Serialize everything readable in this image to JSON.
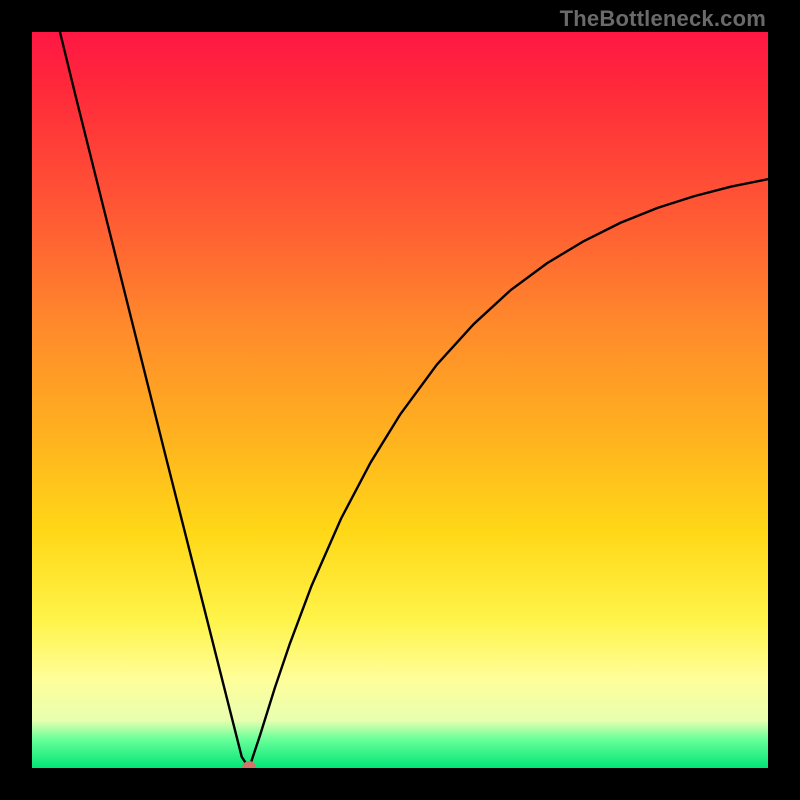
{
  "watermark": "TheBottleneck.com",
  "chart_data": {
    "type": "line",
    "title": "",
    "xlabel": "",
    "ylabel": "",
    "xlim": [
      0,
      1
    ],
    "ylim": [
      0,
      1
    ],
    "grid": false,
    "curve_note": "V-shaped curve: steep descent from top-left, hitting near-zero around x≈0.29, then rising with diminishing slope toward the right edge, asymptoting near y≈0.80.",
    "x": [
      0.038,
      0.06,
      0.08,
      0.1,
      0.12,
      0.14,
      0.16,
      0.18,
      0.2,
      0.22,
      0.24,
      0.265,
      0.285,
      0.295,
      0.31,
      0.33,
      0.35,
      0.38,
      0.42,
      0.46,
      0.5,
      0.55,
      0.6,
      0.65,
      0.7,
      0.75,
      0.8,
      0.85,
      0.9,
      0.95,
      1.0
    ],
    "y": [
      1.0,
      0.91,
      0.83,
      0.75,
      0.67,
      0.59,
      0.51,
      0.43,
      0.351,
      0.272,
      0.193,
      0.094,
      0.015,
      0.0,
      0.045,
      0.109,
      0.168,
      0.248,
      0.339,
      0.415,
      0.48,
      0.548,
      0.603,
      0.649,
      0.686,
      0.716,
      0.741,
      0.761,
      0.777,
      0.79,
      0.8
    ],
    "minimum_marker": {
      "x": 0.295,
      "y": 0.0,
      "color": "#d2746a",
      "radius_px": 7
    },
    "background_color_stops": [
      {
        "pct": 0,
        "hex": "#ff1744"
      },
      {
        "pct": 8,
        "hex": "#ff2a3a"
      },
      {
        "pct": 25,
        "hex": "#ff5a34"
      },
      {
        "pct": 40,
        "hex": "#ff8a2b"
      },
      {
        "pct": 55,
        "hex": "#ffb21f"
      },
      {
        "pct": 68,
        "hex": "#ffd817"
      },
      {
        "pct": 80,
        "hex": "#fff44a"
      },
      {
        "pct": 88,
        "hex": "#fffe9a"
      },
      {
        "pct": 93.5,
        "hex": "#e8ffb0"
      },
      {
        "pct": 96,
        "hex": "#6cff9a"
      },
      {
        "pct": 100,
        "hex": "#00e676"
      }
    ]
  }
}
